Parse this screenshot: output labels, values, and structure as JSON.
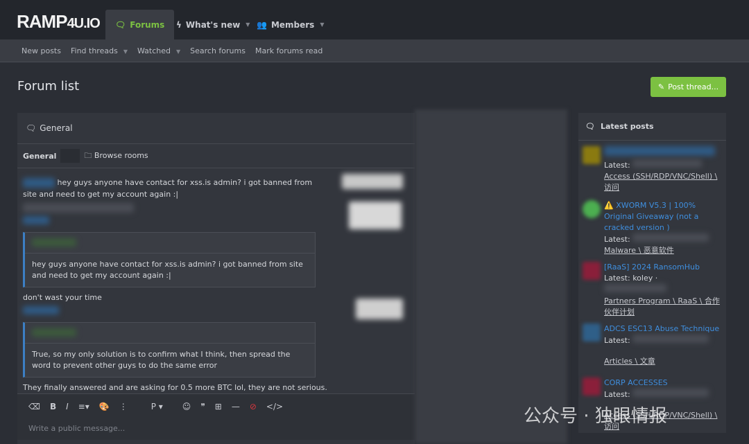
{
  "header": {
    "logo": "RAMP",
    "logo_suffix": "4U.IO",
    "tabs": [
      {
        "label": "Forums",
        "icon": "chat-bubbles-icon",
        "active": true
      },
      {
        "label": "What's new",
        "icon": "bolt-icon"
      },
      {
        "label": "Members",
        "icon": "users-icon"
      }
    ]
  },
  "subnav": [
    "New posts",
    "Find threads",
    "Watched",
    "Search forums",
    "Mark forums read"
  ],
  "page": {
    "title": "Forum list",
    "post_thread": "Post thread..."
  },
  "chat": {
    "title": "General",
    "room_tab": "General",
    "browse_rooms": "Browse rooms",
    "messages": {
      "m1": "hey guys anyone have contact for xss.is admin? i got banned from site and need to get my account again :|",
      "q1": "hey guys anyone have contact for xss.is admin? i got banned from site and need to get my account again :|",
      "m2": "don't wast your time",
      "q2": "True, so my only solution is to confirm what I think, then spread the word to prevent other guys to do the same error",
      "m3": "They finally answered and are asking for 0.5 more BTC lol, they are not serious."
    },
    "paragraph_format": "P",
    "input_placeholder": "Write a public message..."
  },
  "latest": {
    "title": "Latest posts",
    "latest_label": "Latest:",
    "posts": [
      {
        "title": "",
        "latest": "",
        "forum": "Access (SSH/RDP/VNC/Shell) \\ 访问",
        "avatar": "#8a7a10"
      },
      {
        "title": "⚠️ XWORM V5.3 | 100% Original Giveaway (not a cracked version )",
        "latest": "",
        "forum": "Malware \\ 恶意软件",
        "avatar": "#4caf50"
      },
      {
        "title": "[RaaS] 2024 RansomHub",
        "latest": "koley · ",
        "forum": "Partners Program \\ RaaS \\ 合作伙伴计划",
        "avatar": "#8a1f3a"
      },
      {
        "title": "ADCS ESC13 Abuse Technique",
        "latest": "",
        "forum": "Articles \\ 文章",
        "avatar": "#2f5f88"
      },
      {
        "title": "CORP ACCESSES",
        "latest": "",
        "forum": "Access (SSH/RDP/VNC/Shell) \\ 访问",
        "avatar": "#8a1f3a"
      }
    ]
  },
  "watermark": "公众号 · 独眼情报",
  "colors": {
    "accent": "#7cc142",
    "link": "#3f8fdf",
    "quote_bar": "#3c7fc4"
  }
}
